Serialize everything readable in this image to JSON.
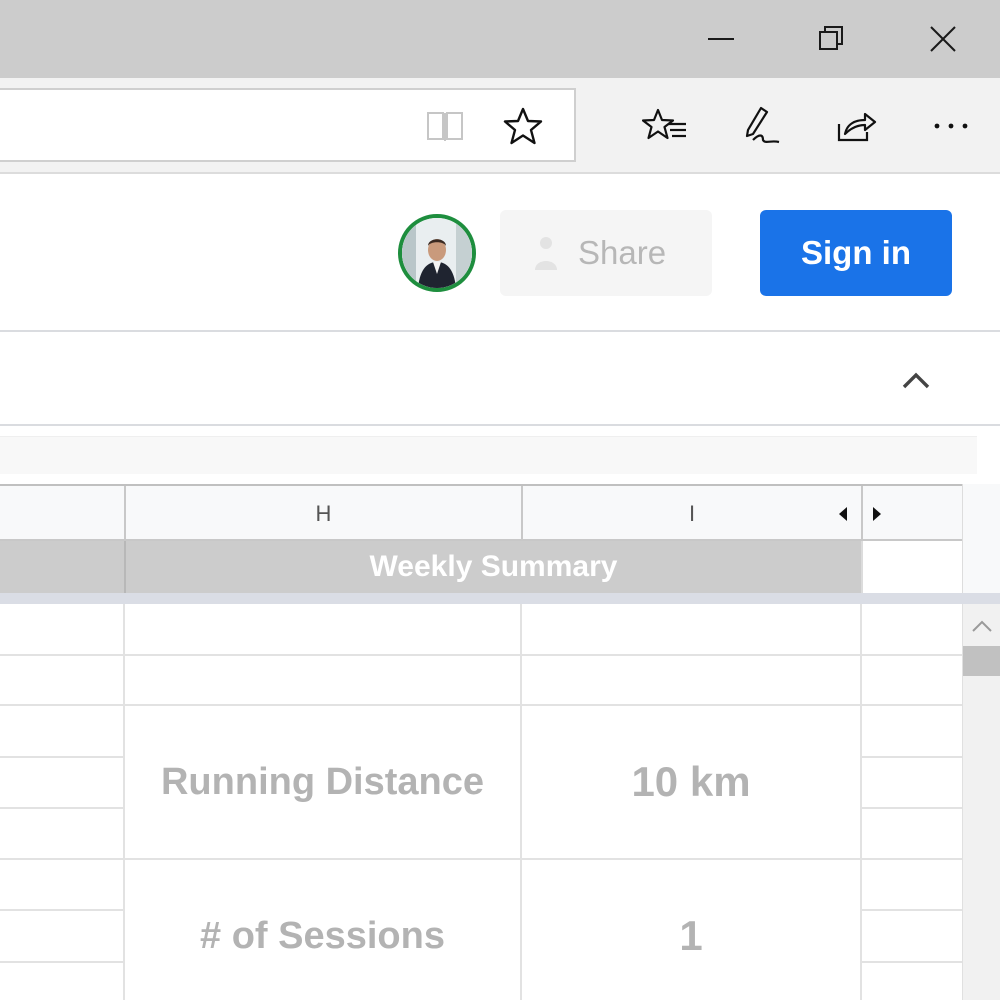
{
  "window_controls": {
    "minimize": "minimize-icon",
    "restore": "restore-icon",
    "close": "close-icon"
  },
  "browser_toolbar": {
    "icons": [
      "reading-view-icon",
      "star-icon",
      "favorites-hub-icon",
      "pen-icon",
      "share-icon",
      "more-icon"
    ]
  },
  "header": {
    "share_label": "Share",
    "signin_label": "Sign in",
    "accent_color": "#1a73e8",
    "avatar_ring_color": "#1e8e3e"
  },
  "grid": {
    "columns": [
      "",
      "H",
      "I",
      ""
    ],
    "frozen_row": {
      "title": "Weekly Summary"
    },
    "summary": [
      {
        "label": "Running Distance",
        "value": "10 km"
      },
      {
        "label": "# of Sessions",
        "value": "1"
      }
    ]
  }
}
